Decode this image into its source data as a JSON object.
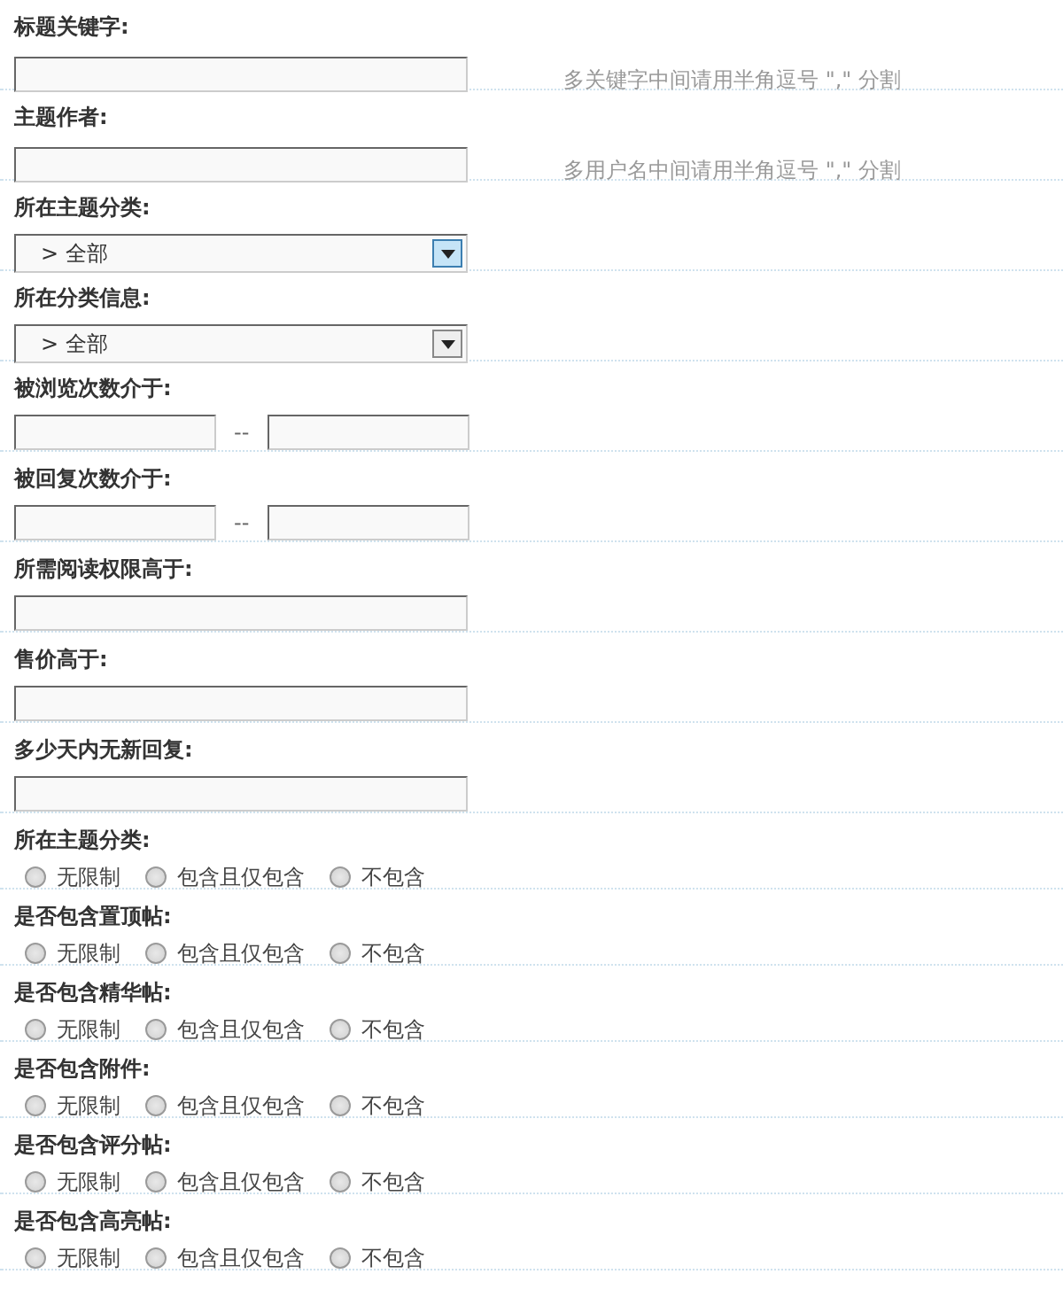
{
  "fields": [
    {
      "kind": "text",
      "label": "标题关键字:",
      "hint": "多关键字中间请用半角逗号 \",\" 分割"
    },
    {
      "kind": "text",
      "label": "主题作者:",
      "hint": "多用户名中间请用半角逗号 \",\" 分割"
    },
    {
      "kind": "select",
      "label": "所在主题分类:",
      "value": "> 全部",
      "hovered": true
    },
    {
      "kind": "select",
      "label": "所在分类信息:",
      "value": "> 全部",
      "hovered": false
    },
    {
      "kind": "range",
      "label": "被浏览次数介于:",
      "separator": "--"
    },
    {
      "kind": "range",
      "label": "被回复次数介于:",
      "separator": "--"
    },
    {
      "kind": "text",
      "label": "所需阅读权限高于:"
    },
    {
      "kind": "text",
      "label": "售价高于:"
    },
    {
      "kind": "text",
      "label": "多少天内无新回复:"
    },
    {
      "kind": "radio",
      "label": "所在主题分类:",
      "options": [
        {
          "label": "无限制",
          "selected": false
        },
        {
          "label": "包含且仅包含",
          "selected": false
        },
        {
          "label": "不包含",
          "selected": false
        }
      ]
    },
    {
      "kind": "radio",
      "label": "是否包含置顶帖:",
      "options": [
        {
          "label": "无限制",
          "selected": false
        },
        {
          "label": "包含且仅包含",
          "selected": false
        },
        {
          "label": "不包含",
          "selected": false
        }
      ]
    },
    {
      "kind": "radio",
      "label": "是否包含精华帖:",
      "options": [
        {
          "label": "无限制",
          "selected": false
        },
        {
          "label": "包含且仅包含",
          "selected": false
        },
        {
          "label": "不包含",
          "selected": false
        }
      ]
    },
    {
      "kind": "radio",
      "label": "是否包含附件:",
      "options": [
        {
          "label": "无限制",
          "selected": false
        },
        {
          "label": "包含且仅包含",
          "selected": false
        },
        {
          "label": "不包含",
          "selected": false
        }
      ]
    },
    {
      "kind": "radio",
      "label": "是否包含评分帖:",
      "options": [
        {
          "label": "无限制",
          "selected": false
        },
        {
          "label": "包含且仅包含",
          "selected": false
        },
        {
          "label": "不包含",
          "selected": false
        }
      ]
    },
    {
      "kind": "radio",
      "label": "是否包含高亮帖:",
      "options": [
        {
          "label": "无限制",
          "selected": false
        },
        {
          "label": "包含且仅包含",
          "selected": false
        },
        {
          "label": "不包含",
          "selected": false
        }
      ]
    }
  ]
}
